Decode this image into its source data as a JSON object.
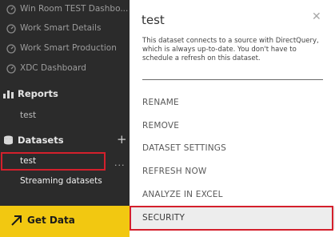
{
  "sidebar": {
    "dashboards": [
      {
        "label": "Win Room TEST Dashbo...",
        "icon": "dashboard-icon"
      },
      {
        "label": "Work Smart Details",
        "icon": "dashboard-icon"
      },
      {
        "label": "Work Smart Production",
        "icon": "dashboard-icon"
      },
      {
        "label": "XDC Dashboard",
        "icon": "dashboard-icon"
      }
    ],
    "reports_title": "Reports",
    "reports": [
      {
        "label": "test"
      }
    ],
    "datasets_title": "Datasets",
    "add_symbol": "+",
    "datasets": [
      {
        "label": "test",
        "selected": true
      },
      {
        "label": "Streaming datasets"
      }
    ],
    "ellipsis": "...",
    "get_data_label": "Get Data",
    "colors": {
      "background": "#2b2b2b",
      "get_data": "#f2c811",
      "highlight": "#d4202c"
    }
  },
  "panel": {
    "title": "test",
    "close_symbol": "✕",
    "description": "This dataset connects to a source with DirectQuery, which is always up-to-date. You don't have to schedule a refresh on this dataset.",
    "menu": [
      {
        "label": "RENAME"
      },
      {
        "label": "REMOVE"
      },
      {
        "label": "DATASET SETTINGS"
      },
      {
        "label": "REFRESH NOW"
      },
      {
        "label": "ANALYZE IN EXCEL"
      },
      {
        "label": "SECURITY",
        "selected": true
      }
    ]
  }
}
